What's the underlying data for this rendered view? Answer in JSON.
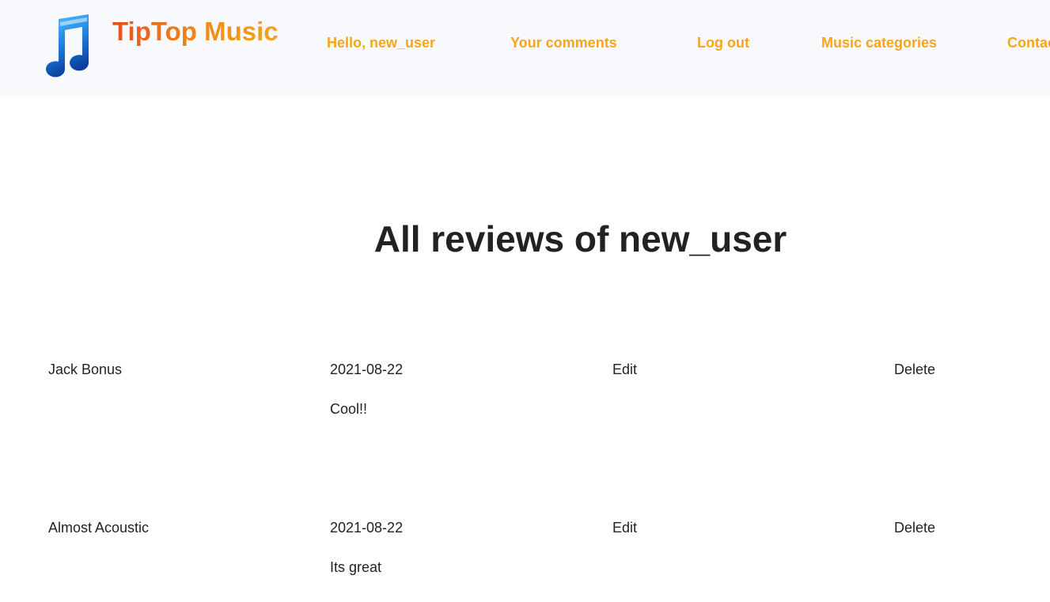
{
  "header": {
    "brand": "TipTop Music",
    "logo_icon": "music-note-icon",
    "nav": [
      {
        "label": "Hello, new_user"
      },
      {
        "label": "Your comments"
      },
      {
        "label": "Log out"
      },
      {
        "label": "Music categories"
      },
      {
        "label": "Contact"
      }
    ]
  },
  "main": {
    "title": "All reviews of new_user",
    "reviews": [
      {
        "album": "Jack Bonus",
        "date": "2021-08-22",
        "comment": "Cool!!",
        "edit_label": "Edit",
        "delete_label": "Delete"
      },
      {
        "album": "Almost Acoustic",
        "date": "2021-08-22",
        "comment": "Its great",
        "edit_label": "Edit",
        "delete_label": "Delete"
      }
    ]
  },
  "colors": {
    "header_bg": "#f8f9fd",
    "nav_link": "#f6a51d",
    "brand_start": "#e8511c",
    "brand_end": "#f3a41d",
    "text": "#222222"
  }
}
